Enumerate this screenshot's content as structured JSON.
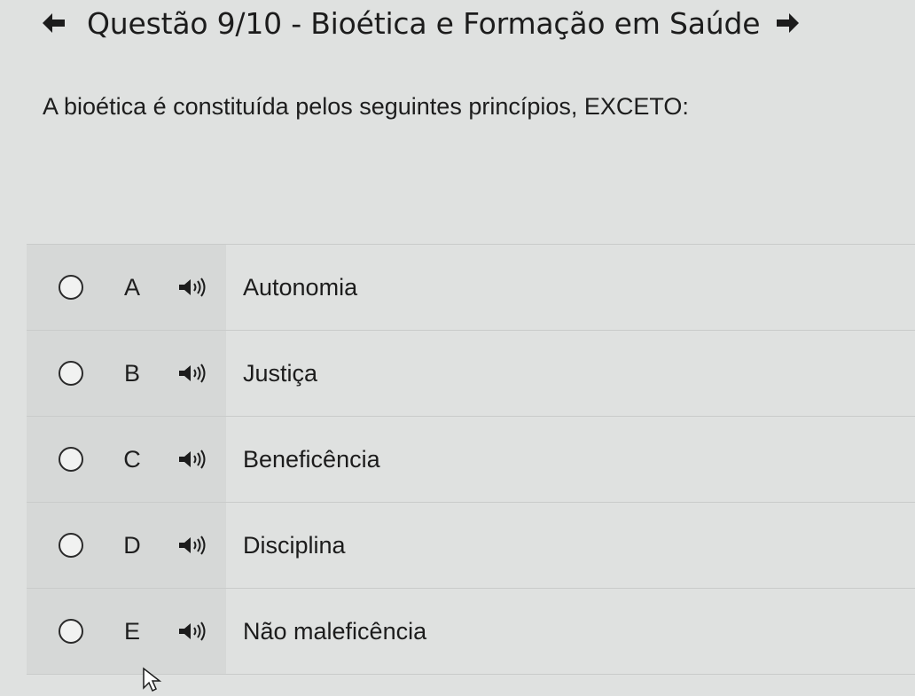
{
  "header": {
    "title": "Questão 9/10 - Bioética e Formação em Saúde",
    "prev_icon": "arrow-left-icon",
    "next_icon": "arrow-right-icon"
  },
  "question": {
    "text": "A bioética é constituída pelos seguintes princípios, EXCETO:"
  },
  "options": [
    {
      "letter": "A",
      "text": "Autonomia",
      "icon": "speaker-icon"
    },
    {
      "letter": "B",
      "text": "Justiça",
      "icon": "speaker-icon"
    },
    {
      "letter": "C",
      "text": "Beneficência",
      "icon": "speaker-icon"
    },
    {
      "letter": "D",
      "text": "Disciplina",
      "icon": "speaker-icon"
    },
    {
      "letter": "E",
      "text": "Não maleficência",
      "icon": "speaker-icon"
    }
  ],
  "colors": {
    "background": "#dfe1e0",
    "panel": "#d6d8d7",
    "text": "#1c1c1c"
  }
}
